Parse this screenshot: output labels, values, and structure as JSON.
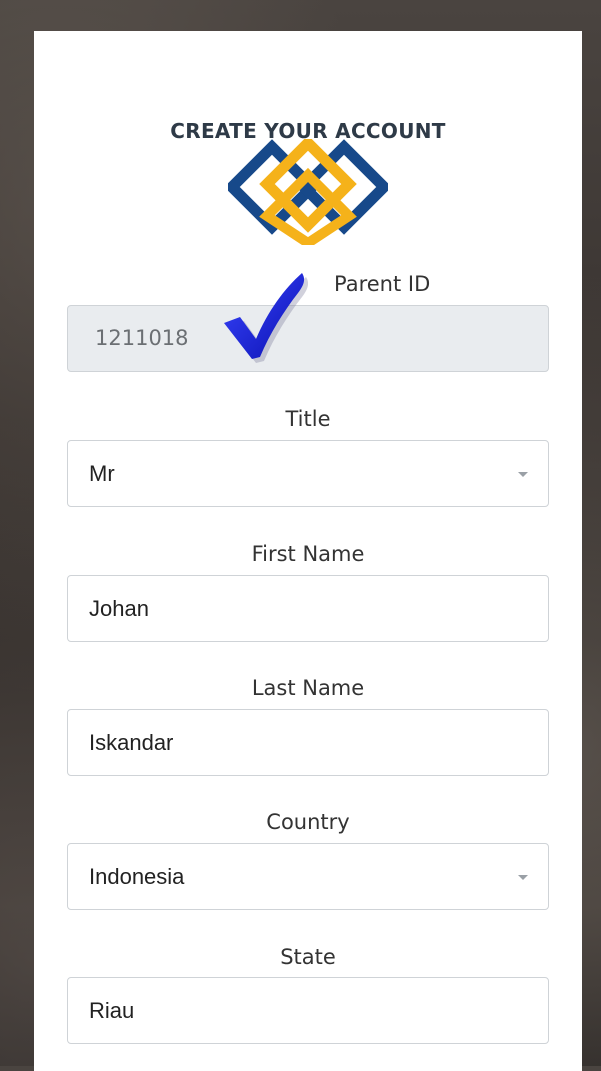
{
  "heading": "CREATE YOUR ACCOUNT",
  "logo": {
    "colors": {
      "blue": "#17498a",
      "gold": "#f5b21a"
    }
  },
  "fields": {
    "parent_id": {
      "label": "Parent ID",
      "value": "1211018"
    },
    "title": {
      "label": "Title",
      "value": "Mr"
    },
    "first_name": {
      "label": "First Name",
      "value": "Johan"
    },
    "last_name": {
      "label": "Last Name",
      "value": "Iskandar"
    },
    "country": {
      "label": "Country",
      "value": "Indonesia"
    },
    "state": {
      "label": "State",
      "value": "Riau"
    }
  },
  "annotation": {
    "icon": "checkmark-icon",
    "color": "#1a22d6"
  }
}
